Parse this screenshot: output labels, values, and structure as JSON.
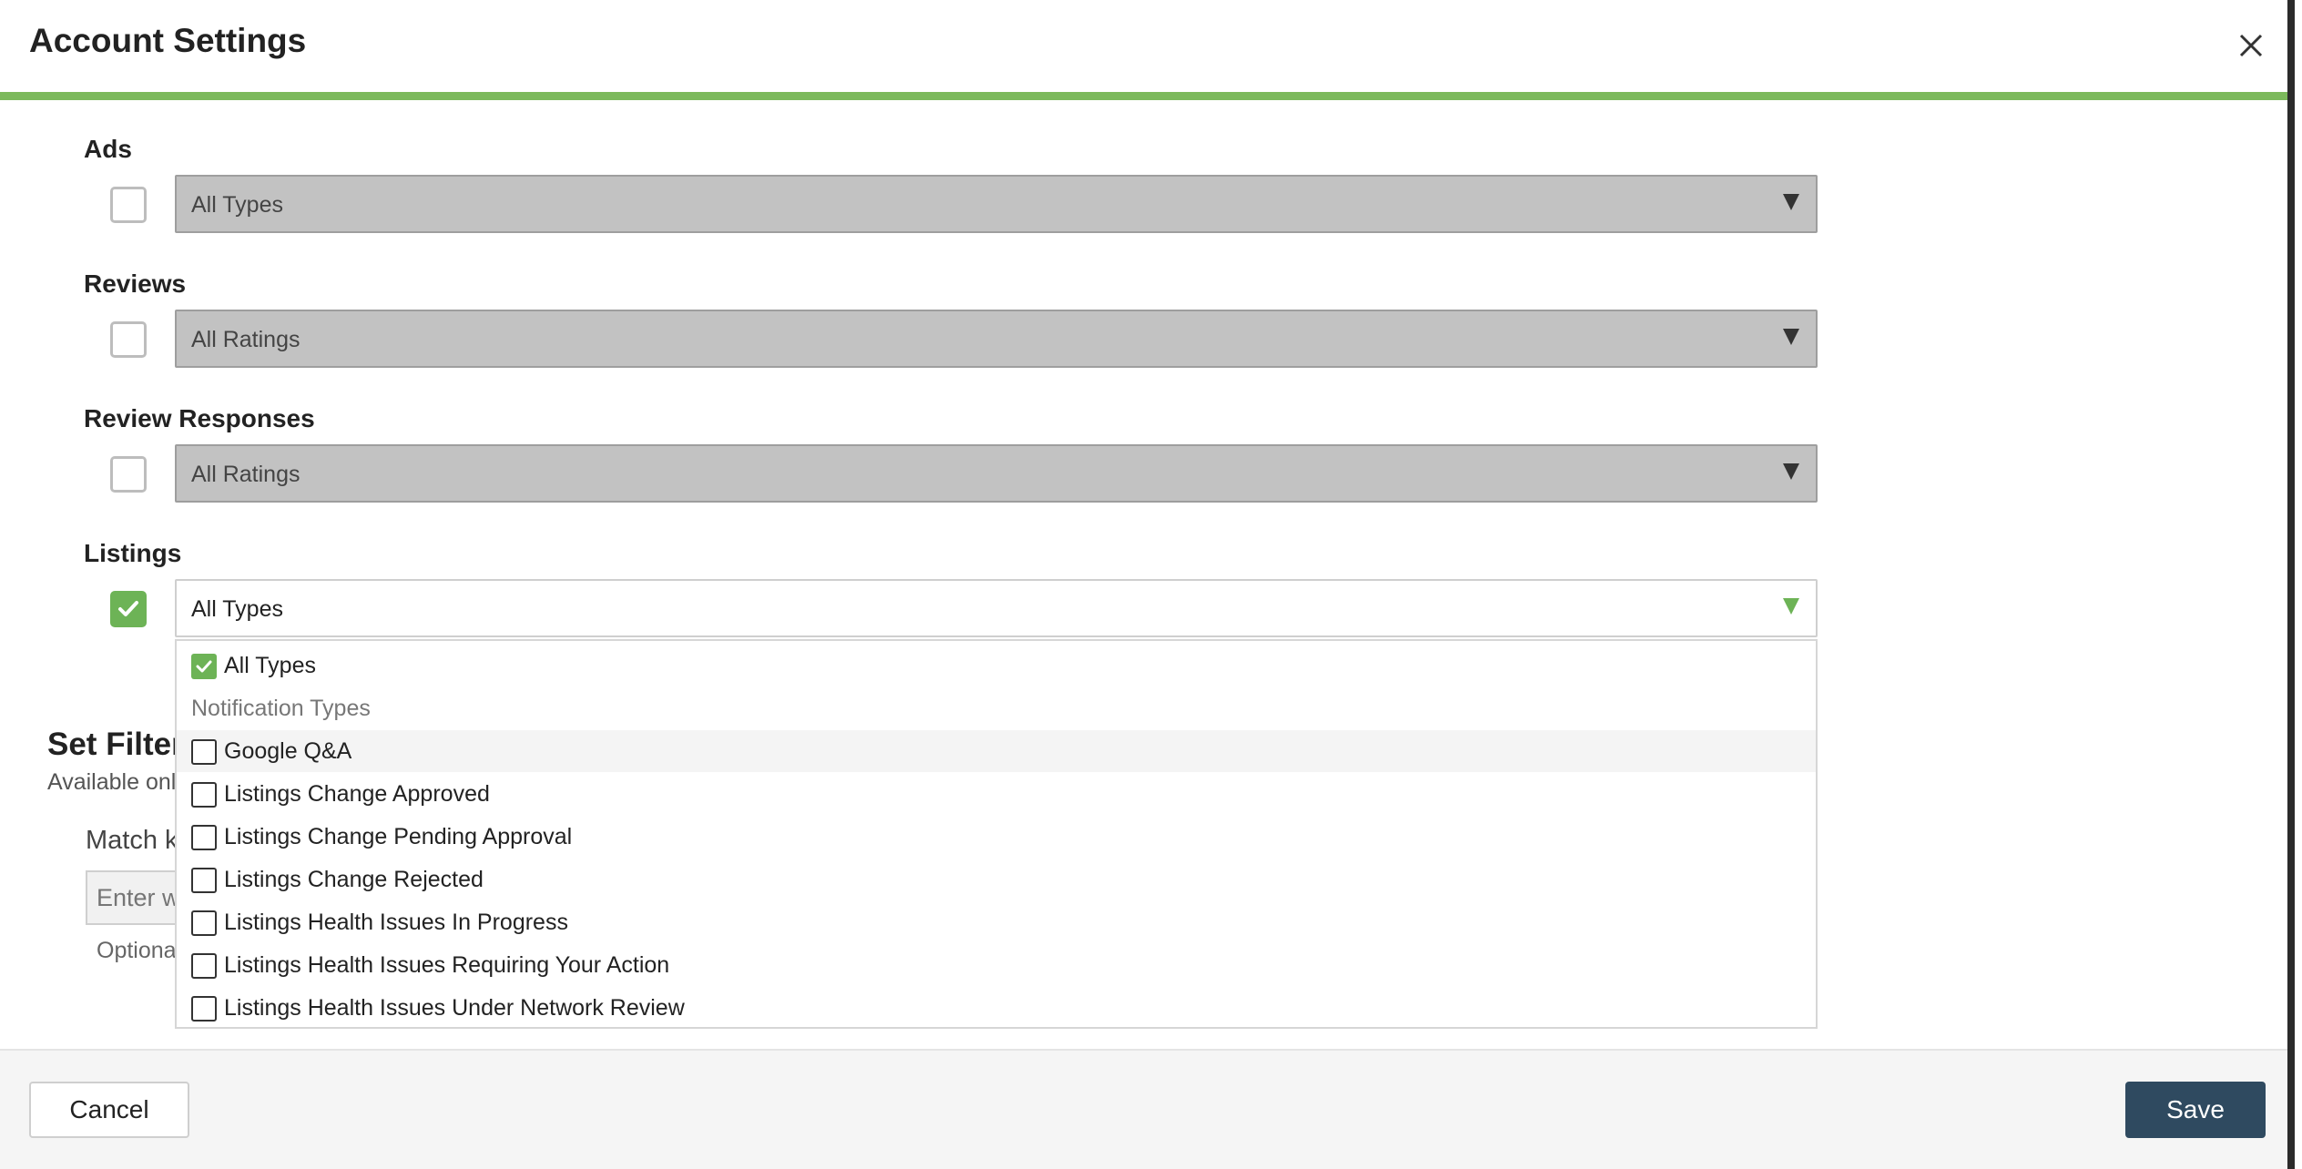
{
  "header": {
    "title": "Account Settings",
    "close_icon": "close-icon"
  },
  "sections": [
    {
      "label": "Ads",
      "checked": false,
      "select_value": "All Types"
    },
    {
      "label": "Reviews",
      "checked": false,
      "select_value": "All Ratings"
    },
    {
      "label": "Review Responses",
      "checked": false,
      "select_value": "All Ratings"
    },
    {
      "label": "Listings",
      "checked": true,
      "select_value": "All Types"
    }
  ],
  "filters": {
    "title": "Set Filter",
    "subtitle": "Available onl",
    "match_label": "Match k",
    "match_placeholder": "Enter w",
    "hint": "Optiona"
  },
  "listings_dropdown": {
    "all_option": {
      "label": "All Types",
      "checked": true
    },
    "group_header": "Notification Types",
    "options": [
      {
        "label": "Google Q&A",
        "checked": false,
        "hovered": true
      },
      {
        "label": "Listings Change Approved",
        "checked": false
      },
      {
        "label": "Listings Change Pending Approval",
        "checked": false
      },
      {
        "label": "Listings Change Rejected",
        "checked": false
      },
      {
        "label": "Listings Health Issues In Progress",
        "checked": false
      },
      {
        "label": "Listings Health Issues Requiring Your Action",
        "checked": false
      },
      {
        "label": "Listings Health Issues Under Network Review",
        "checked": false
      }
    ]
  },
  "footer": {
    "cancel_label": "Cancel",
    "save_label": "Save"
  },
  "colors": {
    "accent_green": "#7cb95c",
    "primary_button": "#2f4a60",
    "disabled_select": "#c2c2c2"
  }
}
